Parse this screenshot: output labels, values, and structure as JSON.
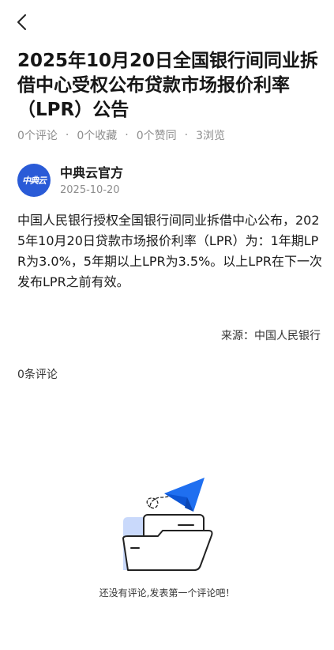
{
  "title": "2025年10月20日全国银行间同业拆借中心受权公布贷款市场报价利率（LPR）公告",
  "stats": {
    "comments": "0个评论",
    "favorites": "0个收藏",
    "likes": "0个赞同",
    "views": "3浏览",
    "separator": "·"
  },
  "author": {
    "avatar_text": "中典云",
    "name": "中典云官方",
    "date": "2025-10-20"
  },
  "content": "中国人民银行授权全国银行间同业拆借中心公布，2025年10月20日贷款市场报价利率（LPR）为：1年期LPR为3.0%，5年期以上LPR为3.5%。以上LPR在下一次发布LPR之前有效。",
  "source": "来源：中国人民银行",
  "comment_count": "0条评论",
  "empty_state": {
    "text": "还没有评论,发表第一个评论吧！",
    "icon": "folder-paper-plane-illustration"
  },
  "colors": {
    "accent": "#2a5bd7",
    "illustration_blue": "#1f6ff0",
    "illustration_light": "#c9d9fb",
    "muted_text": "#8d8d8d"
  },
  "icons": {
    "back": "chevron-left-icon"
  }
}
